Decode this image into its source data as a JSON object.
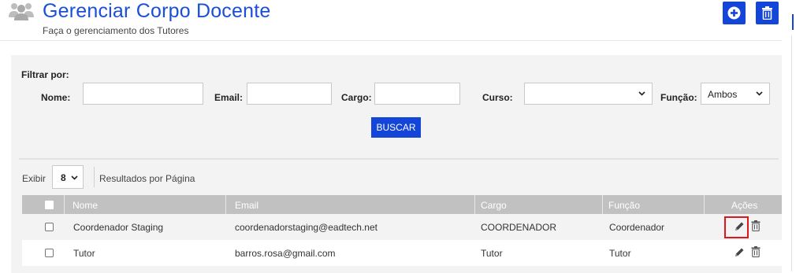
{
  "header": {
    "title": "Gerenciar Corpo Docente",
    "subtitle": "Faça o gerenciamento dos Tutores",
    "icon": "people-group-icon",
    "add_button_icon": "plus-circle-icon",
    "delete_button_icon": "trash-icon"
  },
  "filters": {
    "title": "Filtrar por:",
    "nome_label": "Nome:",
    "nome_value": "",
    "email_label": "Email:",
    "email_value": "",
    "cargo_label": "Cargo:",
    "cargo_value": "",
    "curso_label": "Curso:",
    "curso_value": "",
    "funcao_label": "Função:",
    "funcao_value": "Ambos",
    "search_button": "BUSCAR"
  },
  "pagination": {
    "exibir_label": "Exibir",
    "page_size": "8",
    "results_label": "Resultados por Página"
  },
  "table": {
    "columns": [
      "Nome",
      "Email",
      "Cargo",
      "Função",
      "Ações"
    ],
    "rows": [
      {
        "nome": "Coordenador Staging",
        "email": "coordenadorstaging@eadtech.net",
        "cargo": "COORDENADOR",
        "funcao": "Coordenador"
      },
      {
        "nome": "Tutor",
        "email": "barros.rosa@gmail.com",
        "cargo": "Tutor",
        "funcao": "Tutor"
      }
    ]
  },
  "colors": {
    "accent": "#1346d8",
    "title": "#1a4fd6",
    "table_header": "#c1c1c1",
    "highlight": "#e0161f"
  }
}
